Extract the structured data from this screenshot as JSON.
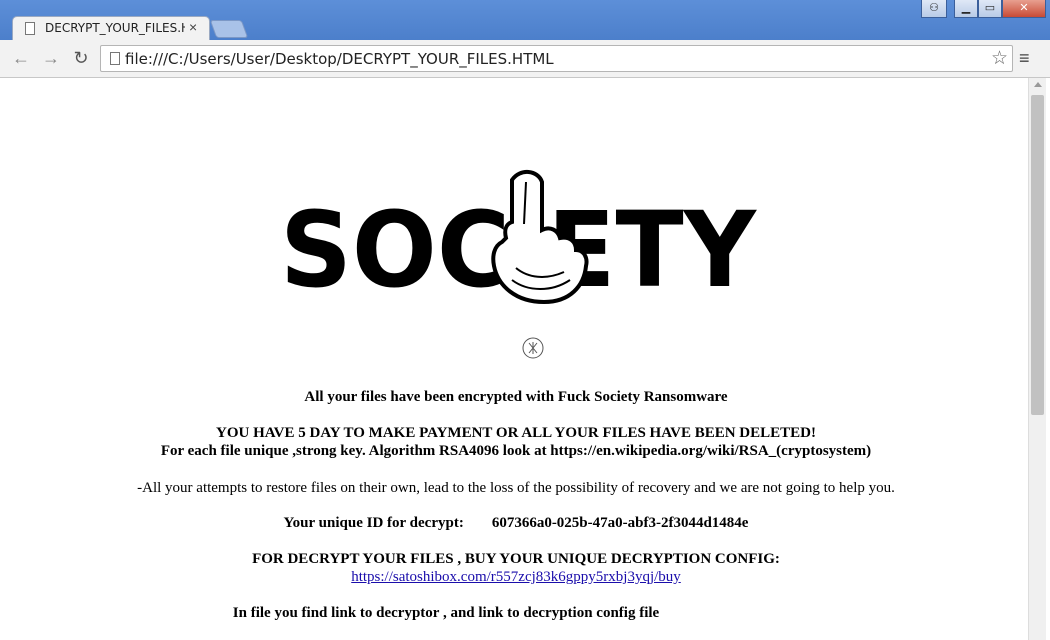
{
  "tab": {
    "title": "DECRYPT_YOUR_FILES.HTML",
    "close_label": "×"
  },
  "toolbar": {
    "back_icon": "←",
    "forward_icon": "→",
    "reload_icon": "↻",
    "url": "file:///C:/Users/User/Desktop/DECRYPT_YOUR_FILES.HTML",
    "star_icon": "☆",
    "menu_icon": "≡"
  },
  "window": {
    "user_icon": "⚇",
    "min_icon": "▁",
    "max_icon": "▭",
    "close_icon": "✕"
  },
  "page": {
    "logo_text": "SOCIETY",
    "line_encrypted": "All your files have been encrypted with Fuck Society Ransomware",
    "line_deadline": "YOU HAVE 5 DAY TO MAKE PAYMENT OR ALL YOUR FILES HAVE BEEN DELETED!",
    "line_key": "For each file unique ,strong key. Algorithm RSA4096 look at https://en.wikipedia.org/wiki/RSA_(cryptosystem)",
    "line_warning": "-All your attempts to restore files on their own, lead to the loss of the possibility of recovery and we are not going to help you.",
    "id_label": "Your unique ID for decrypt:",
    "id_value": "607366a0-025b-47a0-abf3-2f3044d1484e",
    "line_buy": "FOR DECRYPT YOUR FILES , BUY YOUR UNIQUE DECRYPTION CONFIG:",
    "buy_link": "https://satoshibox.com/r557zcj83k6gppy5rxbj3yqj/buy",
    "line_decryptor": "In file you find link to decryptor , and link to decryption config file"
  }
}
